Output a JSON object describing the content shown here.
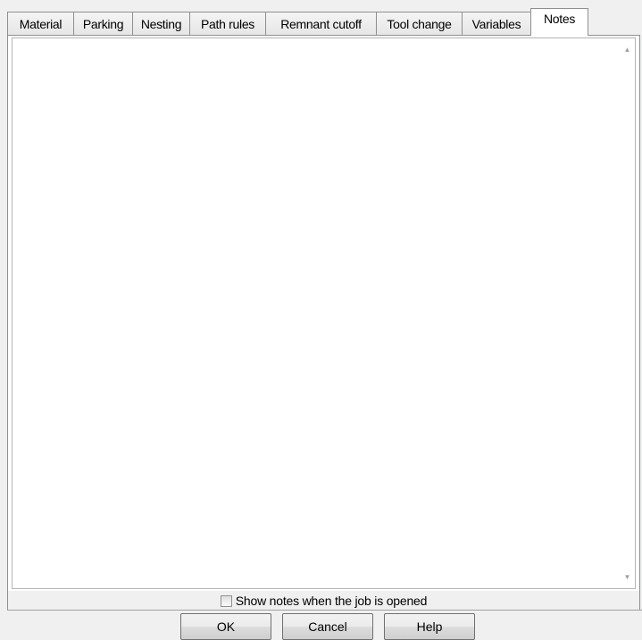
{
  "tabs": [
    {
      "label": "Material"
    },
    {
      "label": "Parking"
    },
    {
      "label": "Nesting"
    },
    {
      "label": "Path rules"
    },
    {
      "label": "Remnant cutoff"
    },
    {
      "label": "Tool change"
    },
    {
      "label": "Variables"
    },
    {
      "label": "Notes",
      "active": true
    }
  ],
  "notes": {
    "value": ""
  },
  "show_notes_checkbox": {
    "label": "Show notes when the job is opened",
    "checked": false
  },
  "buttons": {
    "ok": "OK",
    "cancel": "Cancel",
    "help": "Help"
  },
  "icons": {
    "scroll_up": "scroll-up-arrow",
    "scroll_down": "scroll-down-arrow"
  }
}
